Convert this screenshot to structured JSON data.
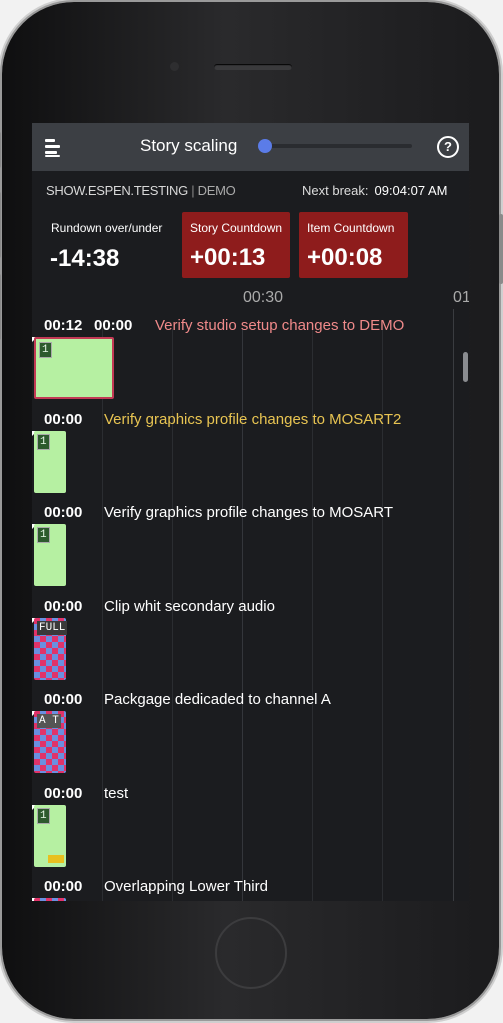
{
  "header": {
    "story_scaling_label": "Story scaling",
    "story_scaling_value": 0.0,
    "help_label": "?"
  },
  "show": {
    "name": "SHOW.ESPEN.TESTING",
    "separator": "|",
    "rundown": "DEMO",
    "next_break_label": "Next break:",
    "next_break_value": "09:04:07 AM"
  },
  "counters": {
    "overunder_label": "Rundown over/under",
    "overunder_value": "-14:38",
    "story_label": "Story Countdown",
    "story_value": "+00:13",
    "item_label": "Item Countdown",
    "item_value": "+00:08"
  },
  "ruler": [
    "00:30",
    "01"
  ],
  "stories": [
    {
      "duration": "00:12",
      "time": "00:00",
      "title": "Verify studio setup changes to DEMO",
      "title_color": "#f08a8a",
      "block": "green",
      "badge": "1"
    },
    {
      "duration": "",
      "time": "00:00",
      "title": "Verify graphics profile changes to MOSART2",
      "title_color": "#e8c452",
      "block": "green",
      "badge": "1"
    },
    {
      "duration": "",
      "time": "00:00",
      "title": "Verify graphics profile changes to MOSART",
      "title_color": "#ffffff",
      "block": "green",
      "badge": "1"
    },
    {
      "duration": "",
      "time": "00:00",
      "title": "Clip whit secondary audio",
      "title_color": "#ffffff",
      "block": "checker",
      "badge": "FULL"
    },
    {
      "duration": "",
      "time": "00:00",
      "title": "Packgage dedicaded to channel A",
      "title_color": "#ffffff",
      "block": "checker",
      "badge": "A T"
    },
    {
      "duration": "",
      "time": "00:00",
      "title": "test",
      "title_color": "#ffffff",
      "block": "green",
      "badge": "1"
    },
    {
      "duration": "",
      "time": "00:00",
      "title": "Overlapping Lower Third",
      "title_color": "#ffffff",
      "block": "checker",
      "badge": ""
    }
  ]
}
